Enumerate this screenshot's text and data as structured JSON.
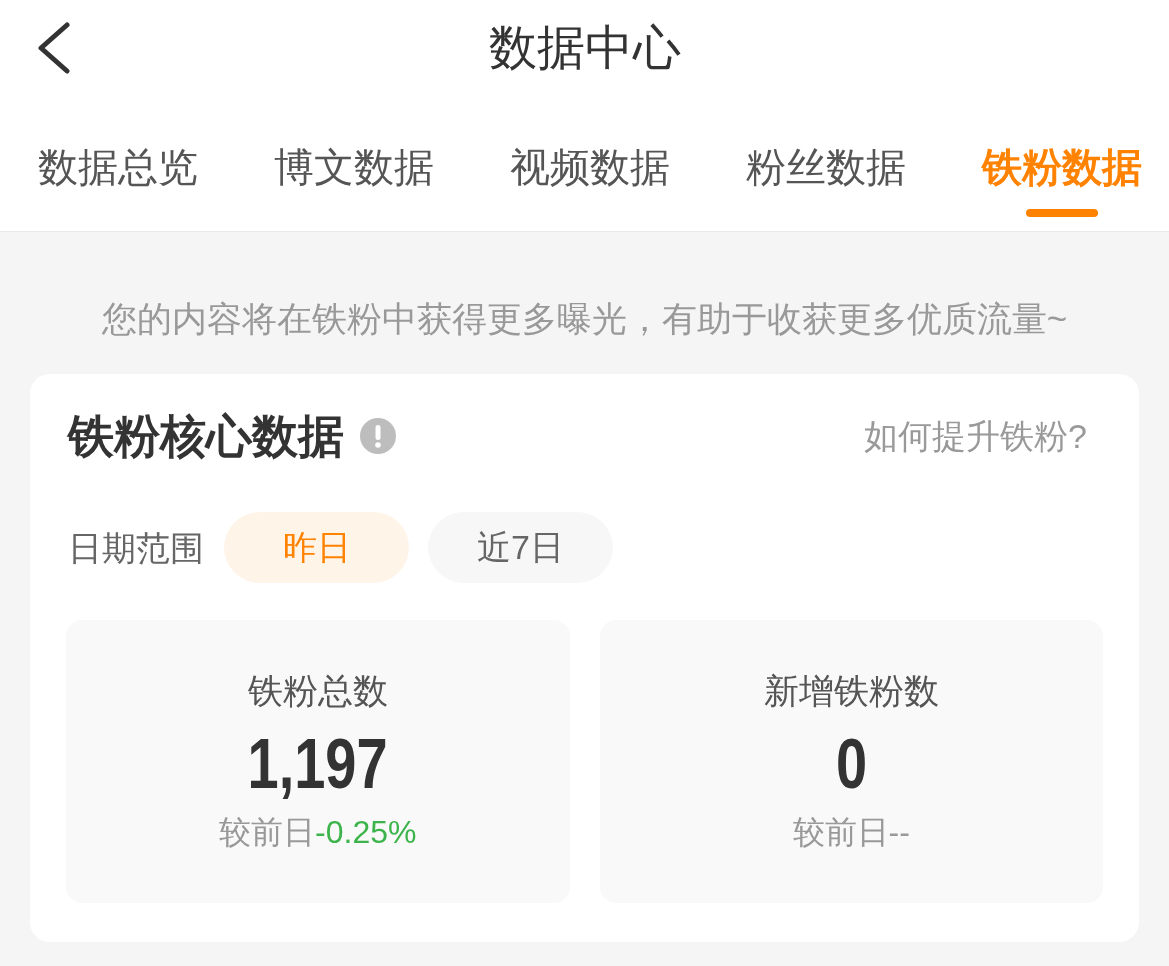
{
  "header": {
    "title": "数据中心"
  },
  "tabs": [
    {
      "label": "数据总览",
      "selected": false
    },
    {
      "label": "博文数据",
      "selected": false
    },
    {
      "label": "视频数据",
      "selected": false
    },
    {
      "label": "粉丝数据",
      "selected": false
    },
    {
      "label": "铁粉数据",
      "selected": true
    }
  ],
  "notice": "您的内容将在铁粉中获得更多曝光，有助于收获更多优质流量~",
  "core_card": {
    "title": "铁粉核心数据",
    "help_link": "如何提升铁粉?",
    "date_range": {
      "label": "日期范围",
      "options": [
        {
          "label": "昨日",
          "selected": true
        },
        {
          "label": "近7日",
          "selected": false
        }
      ]
    },
    "stats": [
      {
        "label": "铁粉总数",
        "value": "1,197",
        "compare_label": "较前日",
        "change": "-0.25%",
        "color": "#3cb44b"
      },
      {
        "label": "新增铁粉数",
        "value": "0",
        "compare_label": "较前日",
        "change": "--",
        "color": "#999999"
      }
    ]
  }
}
